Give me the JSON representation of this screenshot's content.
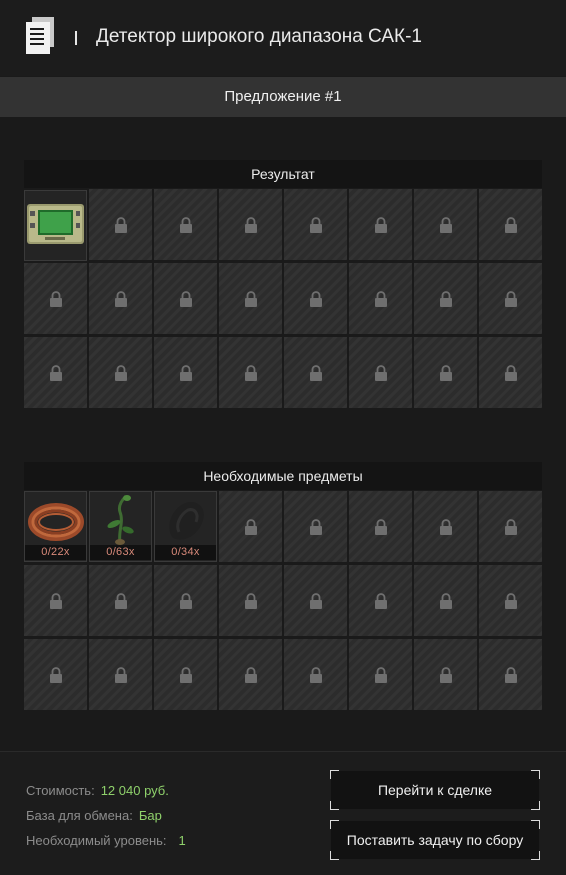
{
  "header": {
    "title": "Детектор широкого диапазона САК-1",
    "icon": "document-icon"
  },
  "offer": {
    "label": "Предложение #1"
  },
  "result_section": {
    "title": "Результат",
    "item": {
      "name": "wide-range-detector",
      "icon": "detector-icon"
    }
  },
  "required_section": {
    "title": "Необходимые предметы",
    "items": [
      {
        "icon": "copper-wire-coil-icon",
        "count": "0/22x"
      },
      {
        "icon": "plant-sprout-icon",
        "count": "0/63x"
      },
      {
        "icon": "dark-rock-icon",
        "count": "0/34x"
      }
    ]
  },
  "info": {
    "cost_label": "Стоимость:",
    "cost_value": "12 040 руб.",
    "base_label": "База для обмена:",
    "base_value": "Бар",
    "level_label": "Необходимый уровень:",
    "level_value": "1"
  },
  "buttons": {
    "go_to_deal": "Перейти к сделке",
    "set_task": "Поставить задачу по сбору"
  },
  "colors": {
    "accent_green": "#8fd16b",
    "count_red": "#d98a7a",
    "background": "#1a1a1a"
  }
}
